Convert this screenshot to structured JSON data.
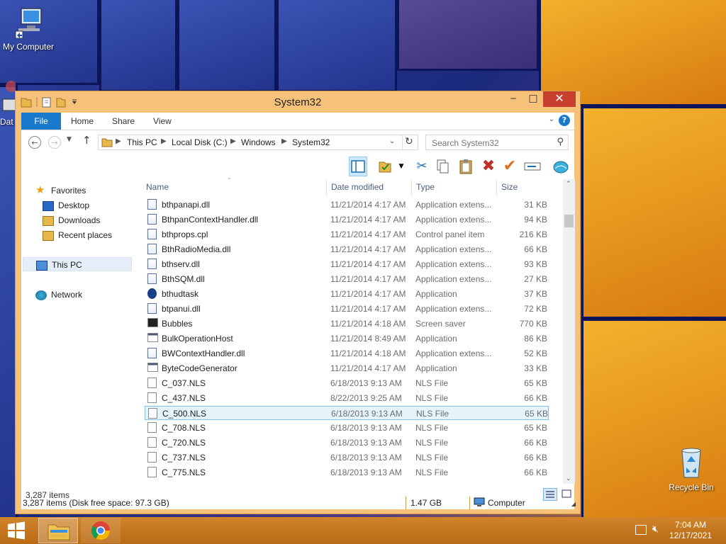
{
  "desktop": {
    "icons": [
      {
        "label": "My Computer"
      },
      {
        "label": "Recycle Bin"
      },
      {
        "label": "Dat"
      }
    ]
  },
  "window": {
    "title": "System32",
    "ribbon_tabs": [
      "File",
      "Home",
      "Share",
      "View"
    ],
    "address": {
      "crumbs": [
        "This PC",
        "Local Disk (C:)",
        "Windows",
        "System32"
      ]
    },
    "search": {
      "placeholder": "Search System32"
    },
    "nav": {
      "favorites": "Favorites",
      "desktop": "Desktop",
      "downloads": "Downloads",
      "recent": "Recent places",
      "this_pc": "This PC",
      "network": "Network"
    },
    "columns": {
      "name": "Name",
      "date": "Date modified",
      "type": "Type",
      "size": "Size"
    },
    "files": [
      {
        "name": "bthpanapi.dll",
        "date": "11/21/2014 4:17 AM",
        "type": "Application extens...",
        "size": "31 KB",
        "icon": "dll"
      },
      {
        "name": "BthpanContextHandler.dll",
        "date": "11/21/2014 4:17 AM",
        "type": "Application extens...",
        "size": "94 KB",
        "icon": "dll"
      },
      {
        "name": "bthprops.cpl",
        "date": "11/21/2014 4:17 AM",
        "type": "Control panel item",
        "size": "216 KB",
        "icon": "dll"
      },
      {
        "name": "BthRadioMedia.dll",
        "date": "11/21/2014 4:17 AM",
        "type": "Application extens...",
        "size": "66 KB",
        "icon": "dll"
      },
      {
        "name": "bthserv.dll",
        "date": "11/21/2014 4:17 AM",
        "type": "Application extens...",
        "size": "93 KB",
        "icon": "dll"
      },
      {
        "name": "BthSQM.dll",
        "date": "11/21/2014 4:17 AM",
        "type": "Application extens...",
        "size": "27 KB",
        "icon": "dll"
      },
      {
        "name": "bthudtask",
        "date": "11/21/2014 4:17 AM",
        "type": "Application",
        "size": "37 KB",
        "icon": "bluetooth"
      },
      {
        "name": "btpanui.dll",
        "date": "11/21/2014 4:17 AM",
        "type": "Application extens...",
        "size": "72 KB",
        "icon": "dll"
      },
      {
        "name": "Bubbles",
        "date": "11/21/2014 4:18 AM",
        "type": "Screen saver",
        "size": "770 KB",
        "icon": "screensaver"
      },
      {
        "name": "BulkOperationHost",
        "date": "11/21/2014 8:49 AM",
        "type": "Application",
        "size": "86 KB",
        "icon": "app"
      },
      {
        "name": "BWContextHandler.dll",
        "date": "11/21/2014 4:18 AM",
        "type": "Application extens...",
        "size": "52 KB",
        "icon": "dll"
      },
      {
        "name": "ByteCodeGenerator",
        "date": "11/21/2014 4:17 AM",
        "type": "Application",
        "size": "33 KB",
        "icon": "app"
      },
      {
        "name": "C_037.NLS",
        "date": "6/18/2013 9:13 AM",
        "type": "NLS File",
        "size": "65 KB",
        "icon": "file"
      },
      {
        "name": "C_437.NLS",
        "date": "8/22/2013 9:25 AM",
        "type": "NLS File",
        "size": "66 KB",
        "icon": "file"
      },
      {
        "name": "C_500.NLS",
        "date": "6/18/2013 9:13 AM",
        "type": "NLS File",
        "size": "65 KB",
        "icon": "file",
        "selected": true
      },
      {
        "name": "C_708.NLS",
        "date": "6/18/2013 9:13 AM",
        "type": "NLS File",
        "size": "65 KB",
        "icon": "file"
      },
      {
        "name": "C_720.NLS",
        "date": "6/18/2013 9:13 AM",
        "type": "NLS File",
        "size": "66 KB",
        "icon": "file"
      },
      {
        "name": "C_737.NLS",
        "date": "6/18/2013 9:13 AM",
        "type": "NLS File",
        "size": "66 KB",
        "icon": "file"
      },
      {
        "name": "C_775.NLS",
        "date": "6/18/2013 9:13 AM",
        "type": "NLS File",
        "size": "66 KB",
        "icon": "file"
      }
    ],
    "status": {
      "item_count": "3,287 items"
    },
    "bottom": {
      "items_info": "3,287 items (Disk free space: 97.3 GB)",
      "size": "1.47 GB",
      "location": "Computer"
    }
  },
  "taskbar": {
    "time": "7:04 AM",
    "date": "12/17/2021"
  },
  "colors": {
    "accent": "#1979ca",
    "window_frame": "#f6c178",
    "close": "#c7402f",
    "taskbar": "#c8761c",
    "selection": "#e5f3fb"
  }
}
